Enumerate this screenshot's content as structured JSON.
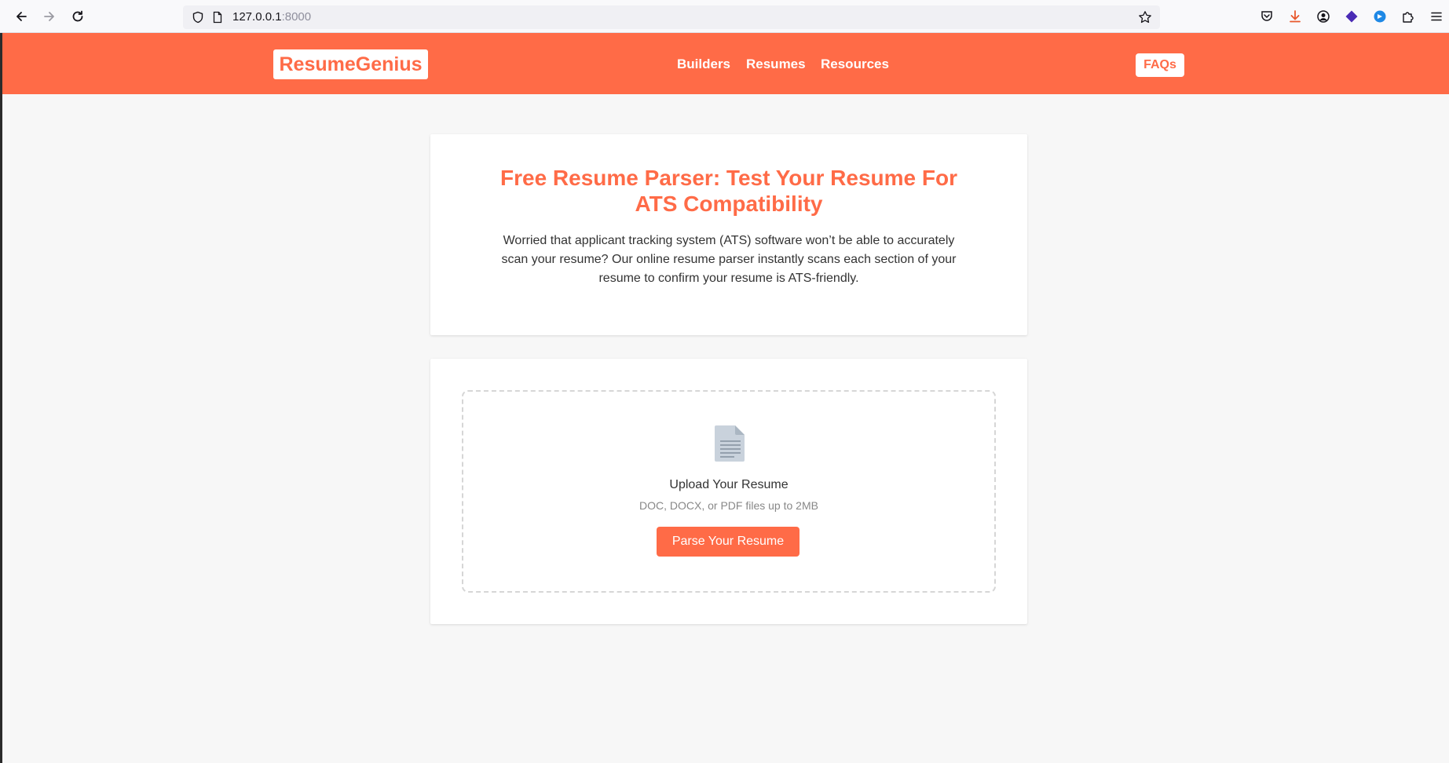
{
  "browser": {
    "url_host": "127.0.0.1",
    "url_port": ":8000"
  },
  "header": {
    "logo": "ResumeGenius",
    "nav": [
      {
        "label": "Builders"
      },
      {
        "label": "Resumes"
      },
      {
        "label": "Resources"
      }
    ],
    "faq_label": "FAQs"
  },
  "hero": {
    "title": "Free Resume Parser: Test Your Resume For ATS Compatibility",
    "description": "Worried that applicant tracking system (ATS) software won’t be able to accurately scan your resume? Our online resume parser instantly scans each section of your resume to confirm your resume is ATS-friendly."
  },
  "upload": {
    "icon": "document-icon",
    "title": "Upload Your Resume",
    "hint": "DOC, DOCX, or PDF files up to 2MB",
    "button_label": "Parse Your Resume"
  },
  "colors": {
    "brand": "#ff6b47",
    "background": "#f7f7f7"
  }
}
